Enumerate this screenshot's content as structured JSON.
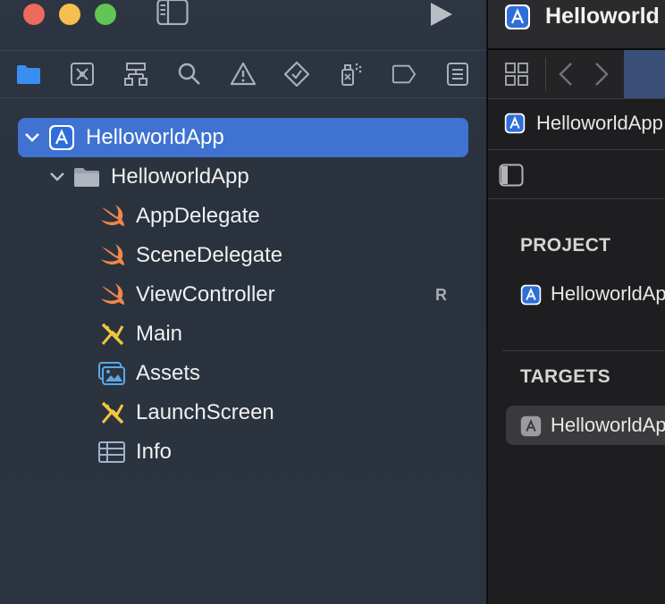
{
  "window": {
    "traffic_lights": [
      "close-button",
      "minimize-button",
      "zoom-button"
    ],
    "run_icon": "play-icon"
  },
  "navigator_toolbar": {
    "icons": [
      "folder-icon",
      "source-control-icon",
      "hierarchy-icon",
      "search-icon",
      "warning-icon",
      "test-diamond-icon",
      "debug-spray-icon",
      "breakpoint-icon",
      "report-icon"
    ],
    "active": "folder-icon",
    "accent": "#3b8ef0"
  },
  "tree": {
    "project": {
      "label": "HelloworldApp",
      "icon": "app-project-icon"
    },
    "group": {
      "label": "HelloworldApp",
      "icon": "folder-icon"
    },
    "files": [
      {
        "label": "AppDelegate",
        "icon": "swift-icon",
        "badge": ""
      },
      {
        "label": "SceneDelegate",
        "icon": "swift-icon",
        "badge": ""
      },
      {
        "label": "ViewController",
        "icon": "swift-icon",
        "badge": "R"
      },
      {
        "label": "Main",
        "icon": "storyboard-icon",
        "badge": ""
      },
      {
        "label": "Assets",
        "icon": "assets-icon",
        "badge": ""
      },
      {
        "label": "LaunchScreen",
        "icon": "storyboard-icon",
        "badge": ""
      },
      {
        "label": "Info",
        "icon": "plist-table-icon",
        "badge": ""
      }
    ]
  },
  "editor": {
    "title": "Helloworld",
    "jump_bar_label": "HelloworldApp",
    "project_heading": "PROJECT",
    "project_item": "HelloworldAp",
    "targets_heading": "TARGETS",
    "target_item": "HelloworldAp"
  },
  "colors": {
    "selection": "#3f72d1",
    "swift": "#f0874a",
    "storyboard": "#f2c63c",
    "assets": "#5aa9e6"
  }
}
